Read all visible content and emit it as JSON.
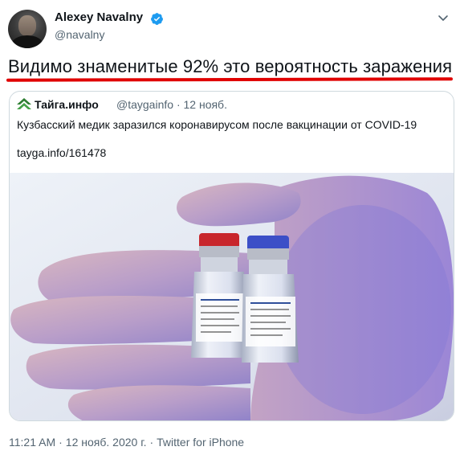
{
  "tweet": {
    "author_name": "Alexey Navalny",
    "author_handle": "@navalny",
    "text": "Видимо знаменитые 92% это вероятность заражения",
    "verified_icon": "verified-badge-icon",
    "more_icon": "chevron-down-icon"
  },
  "quoted": {
    "source_name": "Тайга.инфо",
    "source_handle": "@taygainfo",
    "separator": "·",
    "date": "12 нояб.",
    "text": "Кузбасский медик заразился коронавирусом после вакцинации от COVID-19",
    "link": "tayga.info/161478",
    "logo_icon": "tayga-logo-icon",
    "image": "hand-holding-vaccine-vials"
  },
  "footer": {
    "time": "11:21 AM",
    "separator": "·",
    "date": "12 нояб. 2020 г.",
    "client": "Twitter for iPhone"
  },
  "colors": {
    "accent": "#1d9bf0",
    "underline": "#e00000",
    "secondary_text": "#536471"
  }
}
